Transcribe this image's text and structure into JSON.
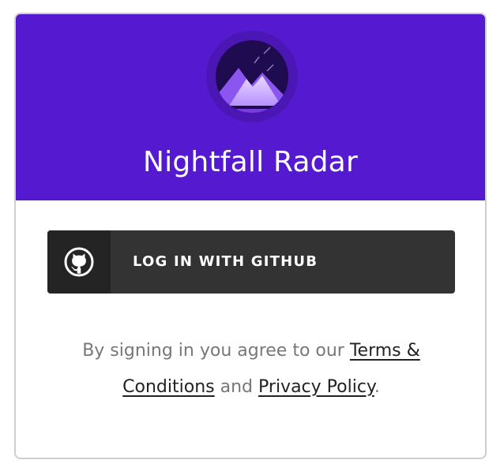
{
  "app": {
    "title": "Nightfall Radar",
    "logo_icon": "mountain-night-logo-icon"
  },
  "login": {
    "github_button_label": "LOG IN WITH GITHUB",
    "github_icon": "github-icon"
  },
  "legal": {
    "prefix": "By signing in you agree to our ",
    "terms_link": "Terms & Conditions",
    "middle": " and ",
    "privacy_link": "Privacy Policy",
    "suffix": "."
  },
  "colors": {
    "header_bg": "#551ad0",
    "button_bg": "#333333",
    "button_icon_bg": "#242424",
    "card_border": "#cfcfcf",
    "muted_text": "#777777",
    "link_text": "#222222"
  }
}
